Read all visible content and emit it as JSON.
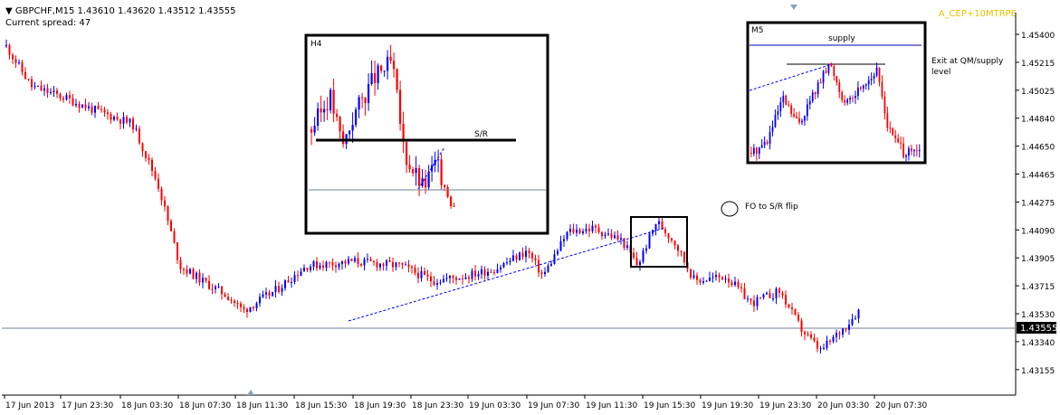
{
  "header": {
    "symbol_line": "GBPCHF,M15  1.43610 1.43620 1.43512 1.43555",
    "spread_line": "Current spread: 47",
    "corner_label": "A_CEP+10MTRPE"
  },
  "colors": {
    "bull": "#0000ff",
    "bear": "#ff0000",
    "grid": "#c0c0c0",
    "axis": "#000000",
    "bid_line": "#708090"
  },
  "price_axis": {
    "ticks": [
      "1.45400",
      "1.45215",
      "1.45025",
      "1.44840",
      "1.44650",
      "1.44465",
      "1.44275",
      "1.44090",
      "1.43905",
      "1.43715",
      "1.43530",
      "1.43340",
      "1.43155"
    ],
    "current_price": "1.43555"
  },
  "time_axis": {
    "ticks": [
      "17 Jun 2013",
      "17 Jun 23:30",
      "18 Jun 03:30",
      "18 Jun 07:30",
      "18 Jun 11:30",
      "18 Jun 15:30",
      "18 Jun 19:30",
      "18 Jun 23:30",
      "19 Jun 03:30",
      "19 Jun 07:30",
      "19 Jun 11:30",
      "19 Jun 15:30",
      "19 Jun 19:30",
      "19 Jun 23:30",
      "20 Jun 03:30",
      "20 Jun 07:30"
    ]
  },
  "annotations": {
    "fo_label": "FO to S/R flip",
    "h4_title": "H4",
    "h4_sr_label": "S/R",
    "m5_title": "M5",
    "m5_supply_label": "supply",
    "m5_exit_label_line1": "Exit at QM/supply",
    "m5_exit_label_line2": "level"
  },
  "chart_data": {
    "type": "candlestick",
    "title": "GBPCHF,M15",
    "ohlc": {
      "open": 1.4361,
      "high": 1.4362,
      "low": 1.43512,
      "close": 1.43555
    },
    "ylim": [
      1.43155,
      1.454
    ],
    "x_range": [
      "17 Jun 2013",
      "20 Jun 07:30"
    ],
    "current_price": 1.43555,
    "close_path": [
      [
        0,
        1.4532
      ],
      [
        8,
        1.4505
      ],
      [
        18,
        1.4498
      ],
      [
        27,
        1.449
      ],
      [
        40,
        1.448
      ],
      [
        48,
        1.444
      ],
      [
        55,
        1.4385
      ],
      [
        62,
        1.4375
      ],
      [
        70,
        1.4365
      ],
      [
        75,
        1.4355
      ],
      [
        85,
        1.4368
      ],
      [
        95,
        1.4385
      ],
      [
        110,
        1.4388
      ],
      [
        125,
        1.4385
      ],
      [
        135,
        1.4375
      ],
      [
        145,
        1.4378
      ],
      [
        155,
        1.4383
      ],
      [
        165,
        1.4395
      ],
      [
        170,
        1.4378
      ],
      [
        178,
        1.4408
      ],
      [
        186,
        1.441
      ],
      [
        195,
        1.4402
      ],
      [
        200,
        1.4385
      ],
      [
        206,
        1.4415
      ],
      [
        212,
        1.44
      ],
      [
        218,
        1.4375
      ],
      [
        228,
        1.4378
      ],
      [
        236,
        1.436
      ],
      [
        245,
        1.4368
      ],
      [
        252,
        1.4342
      ],
      [
        258,
        1.4328
      ],
      [
        266,
        1.4345
      ],
      [
        270,
        1.4355
      ]
    ]
  }
}
